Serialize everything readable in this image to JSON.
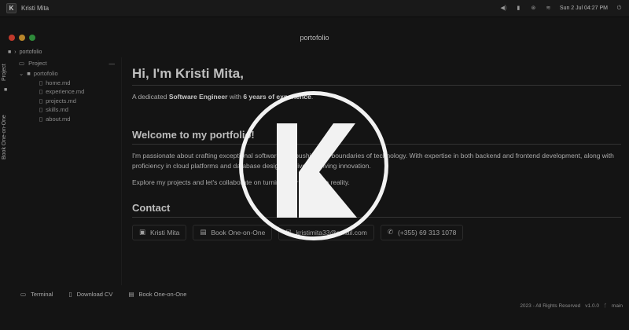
{
  "topbar": {
    "app_name": "Kristi Mita",
    "logo_letter": "K",
    "datetime": "Sun 2 Jul 04:27 PM"
  },
  "window": {
    "title": "portofolio",
    "breadcrumb": "portofolio"
  },
  "left_tabs": {
    "project": "Project",
    "book": "Book One-on-One"
  },
  "sidebar": {
    "header": "Project",
    "collapse": "—",
    "folder": "portofolio",
    "files": [
      "home.md",
      "experience.md",
      "projects.md",
      "skills.md",
      "about.md"
    ]
  },
  "content": {
    "heading": "Hi, I'm Kristi Mita,",
    "intro_prefix": "A dedicated",
    "intro_role": "Software Engineer",
    "intro_mid": "with",
    "intro_years": "6 years of experience",
    "intro_suffix": ".",
    "welcome_heading": "Welcome to my portfolio!",
    "paragraph1": "I'm passionate about crafting exceptional software and pushing the boundaries of technology. With expertise in both backend and frontend development, along with proficiency in cloud platforms and database design, I thrive on driving innovation.",
    "paragraph2": "Explore my projects and let's collaborate on turning your ideas into reality.",
    "contact_heading": "Contact",
    "contacts": [
      {
        "icon": "linkedin-icon",
        "label": "Kristi Mita"
      },
      {
        "icon": "calendar-icon",
        "label": "Book One-on-One"
      },
      {
        "icon": "mail-icon",
        "label": "kristimita33@gmail.com"
      },
      {
        "icon": "phone-icon",
        "label": "(+355) 69 313 1078"
      }
    ]
  },
  "bottombar": {
    "terminal": "Terminal",
    "download_cv": "Download CV",
    "book": "Book One-on-One"
  },
  "statusbar": {
    "copyright": "2023 - All Rights Reserved",
    "version": "v1.0.0",
    "branch": "main"
  },
  "colors": {
    "background": "#141414",
    "overlay": "#f2f2f2",
    "traffic_red": "#c0392b",
    "traffic_yellow": "#b8862b",
    "traffic_green": "#2e8b3a"
  }
}
